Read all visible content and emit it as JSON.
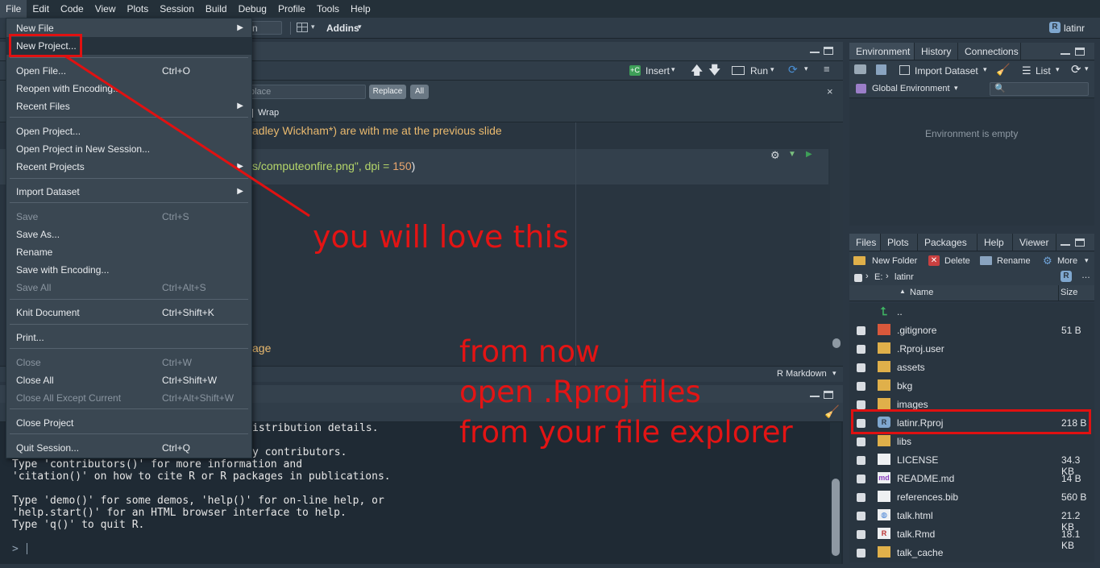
{
  "menubar": [
    "File",
    "Edit",
    "Code",
    "View",
    "Plots",
    "Session",
    "Build",
    "Debug",
    "Profile",
    "Tools",
    "Help"
  ],
  "toolbar": {
    "partial_field": "n",
    "addins_label": "Addins",
    "project_label": "latinr"
  },
  "source": {
    "insert_label": "Insert",
    "run_label": "Run",
    "find_placeholder": "place",
    "replace_label": "Replace",
    "all_label": "All",
    "wrap_label": "Wrap",
    "line1": "adley Wickham*) are with me at the previous slide",
    "line2_a": "s/computeonfire.png\", dpi = ",
    "line2_b": "150",
    "line2_c": ")",
    "line3": "age",
    "mode_label": "R Markdown"
  },
  "console": {
    "lines": [
      "istribution details.",
      "",
      "y contributors.",
      "Type 'contributors()' for more information and",
      "'citation()' on how to cite R or R packages in publications.",
      "",
      "Type 'demo()' for some demos, 'help()' for on-line help, or",
      "'help.start()' for an HTML browser interface to help.",
      "Type 'q()' to quit R."
    ],
    "prompt": ">"
  },
  "environment": {
    "tabs": [
      "Environment",
      "History",
      "Connections"
    ],
    "import_label": "Import Dataset",
    "list_label": "List",
    "global_env": "Global Environment",
    "empty_text": "Environment is empty"
  },
  "files": {
    "tabs": [
      "Files",
      "Plots",
      "Packages",
      "Help",
      "Viewer"
    ],
    "new_folder": "New Folder",
    "delete": "Delete",
    "rename": "Rename",
    "more": "More",
    "path_root": "E:",
    "path_dir": "latinr",
    "col_name": "Name",
    "col_size": "Size",
    "rows": [
      {
        "name": "..",
        "size": "",
        "icon": "up-arrow-icon"
      },
      {
        "name": ".gitignore",
        "size": "51 B",
        "icon": "git-icon"
      },
      {
        "name": ".Rproj.user",
        "size": "",
        "icon": "folder-icon"
      },
      {
        "name": "assets",
        "size": "",
        "icon": "folder-icon"
      },
      {
        "name": "bkg",
        "size": "",
        "icon": "folder-icon"
      },
      {
        "name": "images",
        "size": "",
        "icon": "folder-icon"
      },
      {
        "name": "latinr.Rproj",
        "size": "218 B",
        "icon": "rproj-icon"
      },
      {
        "name": "libs",
        "size": "",
        "icon": "folder-icon"
      },
      {
        "name": "LICENSE",
        "size": "34.3 KB",
        "icon": "file-icon"
      },
      {
        "name": "README.md",
        "size": "14 B",
        "icon": "markdown-icon"
      },
      {
        "name": "references.bib",
        "size": "560 B",
        "icon": "file-icon"
      },
      {
        "name": "talk.html",
        "size": "21.2 KB",
        "icon": "html-icon"
      },
      {
        "name": "talk.Rmd",
        "size": "18.1 KB",
        "icon": "rmd-icon"
      },
      {
        "name": "talk_cache",
        "size": "",
        "icon": "folder-icon"
      }
    ]
  },
  "file_menu": [
    {
      "label": "New File",
      "shortcut": "",
      "submenu": true,
      "disabled": false
    },
    {
      "label": "New Project...",
      "shortcut": "",
      "submenu": false,
      "disabled": false
    },
    {
      "label": "Open File...",
      "shortcut": "Ctrl+O",
      "submenu": false,
      "disabled": false
    },
    {
      "label": "Reopen with Encoding...",
      "shortcut": "",
      "submenu": false,
      "disabled": false
    },
    {
      "label": "Recent Files",
      "shortcut": "",
      "submenu": true,
      "disabled": false
    },
    {
      "label": "Open Project...",
      "shortcut": "",
      "submenu": false,
      "disabled": false
    },
    {
      "label": "Open Project in New Session...",
      "shortcut": "",
      "submenu": false,
      "disabled": false
    },
    {
      "label": "Recent Projects",
      "shortcut": "",
      "submenu": true,
      "disabled": false
    },
    {
      "label": "Import Dataset",
      "shortcut": "",
      "submenu": true,
      "disabled": false
    },
    {
      "label": "Save",
      "shortcut": "Ctrl+S",
      "submenu": false,
      "disabled": true
    },
    {
      "label": "Save As...",
      "shortcut": "",
      "submenu": false,
      "disabled": false
    },
    {
      "label": "Rename",
      "shortcut": "",
      "submenu": false,
      "disabled": false
    },
    {
      "label": "Save with Encoding...",
      "shortcut": "",
      "submenu": false,
      "disabled": false
    },
    {
      "label": "Save All",
      "shortcut": "Ctrl+Alt+S",
      "submenu": false,
      "disabled": true
    },
    {
      "label": "Knit Document",
      "shortcut": "Ctrl+Shift+K",
      "submenu": false,
      "disabled": false
    },
    {
      "label": "Print...",
      "shortcut": "",
      "submenu": false,
      "disabled": false
    },
    {
      "label": "Close",
      "shortcut": "Ctrl+W",
      "submenu": false,
      "disabled": true
    },
    {
      "label": "Close All",
      "shortcut": "Ctrl+Shift+W",
      "submenu": false,
      "disabled": false
    },
    {
      "label": "Close All Except Current",
      "shortcut": "Ctrl+Alt+Shift+W",
      "submenu": false,
      "disabled": true
    },
    {
      "label": "Close Project",
      "shortcut": "",
      "submenu": false,
      "disabled": false
    },
    {
      "label": "Quit Session...",
      "shortcut": "Ctrl+Q",
      "submenu": false,
      "disabled": false
    }
  ],
  "annotations": {
    "love": "you will love this",
    "line1": "from now",
    "line2": "open .Rproj files",
    "line3": "from your file explorer"
  },
  "colors": {
    "annotation_red": "#e31414",
    "accent_blue": "#4a8fd4"
  }
}
